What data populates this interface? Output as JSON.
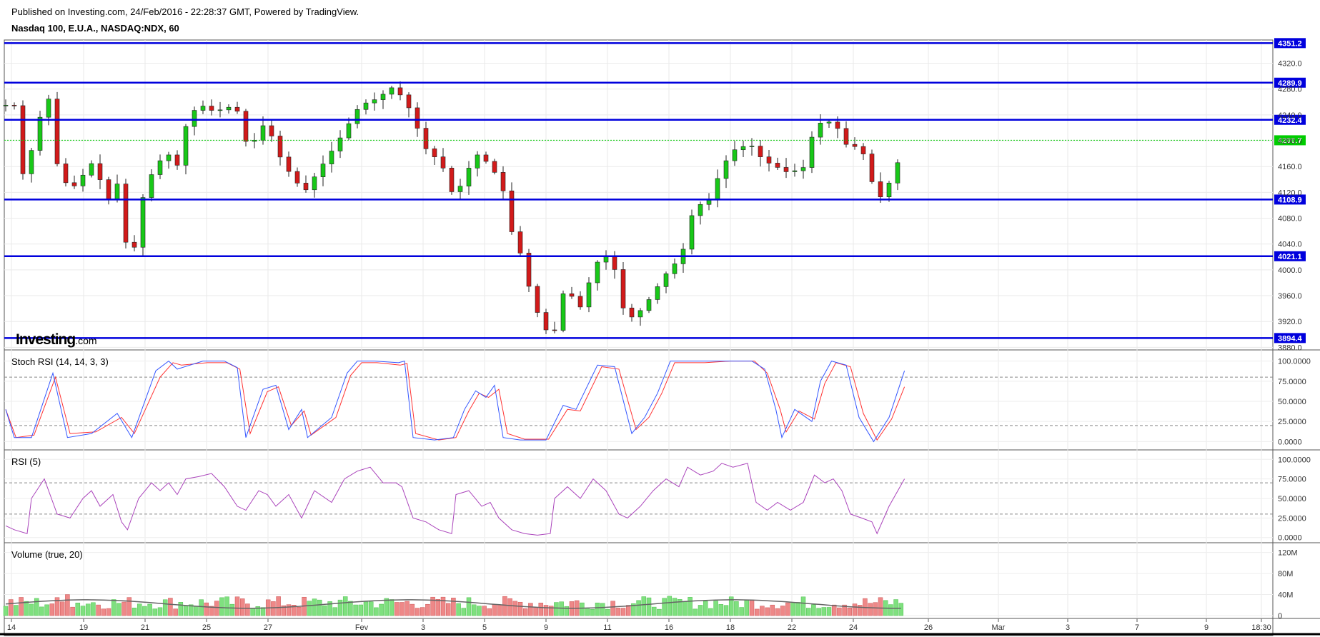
{
  "header": {
    "published": "Published on Investing.com, 24/Feb/2016 - 22:28:37 GMT, Powered by TradingView.",
    "instrument": "Nasdaq 100, E.U.A., NASDAQ:NDX, 60"
  },
  "logo": {
    "main": "Investing",
    "suffix": ".com"
  },
  "colors": {
    "up": "#18c818",
    "down": "#d21a1a",
    "level_line": "#0000dd",
    "current": "#00cc00",
    "stoch_k": "#3355ff",
    "stoch_d": "#ff3333",
    "rsi": "#aa44bb",
    "vol_ma": "#666666"
  },
  "chart_data": [
    {
      "type": "candlestick",
      "title": "Nasdaq 100, E.U.A., NASDAQ:NDX, 60",
      "x_ticks": [
        "14",
        "19",
        "21",
        "25",
        "27",
        "Fev",
        "3",
        "5",
        "9",
        "11",
        "16",
        "18",
        "22",
        "24",
        "26",
        "Mar",
        "3",
        "7",
        "9",
        "18:30"
      ],
      "y_ticks": [
        "4320.0",
        "4280.0",
        "4240.0",
        "4200.0",
        "4160.0",
        "4120.0",
        "4080.0",
        "4040.0",
        "4000.0",
        "3960.0",
        "3920.0",
        "3880.0"
      ],
      "ylim": [
        3876,
        4356
      ],
      "horizontal_levels": [
        "4351.2",
        "4289.9",
        "4232.4",
        "4108.9",
        "4021.1",
        "3894.4"
      ],
      "current_price": "4200.7",
      "grid": true,
      "close_path": [
        [
          0,
          4255
        ],
        [
          5,
          4190
        ],
        [
          12,
          4280
        ],
        [
          18,
          4140
        ],
        [
          26,
          4175
        ],
        [
          36,
          4200
        ],
        [
          47,
          4300
        ],
        [
          58,
          4170
        ],
        [
          70,
          4135
        ],
        [
          80,
          4130
        ],
        [
          92,
          4150
        ],
        [
          103,
          4170
        ],
        [
          118,
          4105
        ],
        [
          133,
          4140
        ],
        [
          142,
          4015
        ],
        [
          152,
          4040
        ],
        [
          162,
          4130
        ],
        [
          178,
          4165
        ],
        [
          188,
          4185
        ],
        [
          198,
          4150
        ],
        [
          213,
          4240
        ],
        [
          228,
          4255
        ],
        [
          243,
          4245
        ],
        [
          268,
          4255
        ],
        [
          283,
          4185
        ],
        [
          303,
          4230
        ],
        [
          323,
          4165
        ],
        [
          348,
          4120
        ],
        [
          368,
          4160
        ],
        [
          388,
          4200
        ],
        [
          413,
          4255
        ],
        [
          433,
          4265
        ],
        [
          453,
          4285
        ],
        [
          473,
          4245
        ],
        [
          488,
          4190
        ],
        [
          508,
          4165
        ],
        [
          523,
          4110
        ],
        [
          548,
          4180
        ],
        [
          563,
          4165
        ],
        [
          578,
          4135
        ],
        [
          593,
          4040
        ],
        [
          603,
          4020
        ],
        [
          613,
          3955
        ],
        [
          628,
          3910
        ],
        [
          638,
          3895
        ],
        [
          653,
          3980
        ],
        [
          668,
          3935
        ],
        [
          688,
          4010
        ],
        [
          703,
          4025
        ],
        [
          713,
          3990
        ],
        [
          723,
          3920
        ],
        [
          743,
          3940
        ],
        [
          758,
          3970
        ],
        [
          773,
          4000
        ],
        [
          788,
          4020
        ],
        [
          798,
          4080
        ],
        [
          808,
          4100
        ],
        [
          823,
          4110
        ],
        [
          833,
          4155
        ],
        [
          848,
          4185
        ],
        [
          868,
          4195
        ],
        [
          883,
          4170
        ],
        [
          898,
          4160
        ],
        [
          913,
          4150
        ],
        [
          933,
          4160
        ],
        [
          943,
          4225
        ],
        [
          958,
          4230
        ],
        [
          968,
          4225
        ],
        [
          978,
          4195
        ],
        [
          993,
          4190
        ],
        [
          1003,
          4175
        ],
        [
          1013,
          4120
        ],
        [
          1023,
          4110
        ],
        [
          1033,
          4145
        ],
        [
          1043,
          4175
        ],
        [
          1048,
          4200
        ]
      ],
      "panels": [
        {
          "name": "Stoch RSI (14, 14, 3, 3)",
          "y_ticks": [
            "100.0000",
            "75.0000",
            "50.0000",
            "25.0000",
            "0.0000"
          ],
          "ylim": [
            -5,
            105
          ],
          "bands": [
            80,
            20
          ],
          "k_points": [
            [
              0,
              40
            ],
            [
              10,
              5
            ],
            [
              30,
              5
            ],
            [
              55,
              85
            ],
            [
              72,
              5
            ],
            [
              100,
              10
            ],
            [
              130,
              35
            ],
            [
              147,
              5
            ],
            [
              175,
              88
            ],
            [
              190,
              100
            ],
            [
              200,
              90
            ],
            [
              230,
              100
            ],
            [
              255,
              100
            ],
            [
              270,
              92
            ],
            [
              280,
              5
            ],
            [
              300,
              65
            ],
            [
              315,
              70
            ],
            [
              330,
              15
            ],
            [
              345,
              40
            ],
            [
              352,
              5
            ],
            [
              380,
              30
            ],
            [
              398,
              85
            ],
            [
              410,
              100
            ],
            [
              430,
              100
            ],
            [
              458,
              98
            ],
            [
              465,
              100
            ],
            [
              475,
              5
            ],
            [
              500,
              2
            ],
            [
              522,
              5
            ],
            [
              535,
              40
            ],
            [
              548,
              63
            ],
            [
              560,
              55
            ],
            [
              570,
              70
            ],
            [
              580,
              5
            ],
            [
              600,
              2
            ],
            [
              630,
              2
            ],
            [
              650,
              45
            ],
            [
              665,
              40
            ],
            [
              690,
              95
            ],
            [
              710,
              93
            ],
            [
              730,
              10
            ],
            [
              745,
              30
            ],
            [
              760,
              60
            ],
            [
              775,
              100
            ],
            [
              790,
              100
            ],
            [
              810,
              100
            ],
            [
              840,
              100
            ],
            [
              870,
              100
            ],
            [
              885,
              90
            ],
            [
              898,
              40
            ],
            [
              905,
              5
            ],
            [
              920,
              40
            ],
            [
              940,
              25
            ],
            [
              950,
              75
            ],
            [
              963,
              100
            ],
            [
              980,
              95
            ],
            [
              995,
              30
            ],
            [
              1012,
              0
            ],
            [
              1030,
              30
            ],
            [
              1048,
              88
            ]
          ],
          "d_points": [
            [
              0,
              40
            ],
            [
              12,
              5
            ],
            [
              33,
              8
            ],
            [
              58,
              80
            ],
            [
              75,
              10
            ],
            [
              105,
              12
            ],
            [
              135,
              30
            ],
            [
              150,
              10
            ],
            [
              180,
              80
            ],
            [
              195,
              98
            ],
            [
              205,
              95
            ],
            [
              235,
              98
            ],
            [
              258,
              98
            ],
            [
              273,
              90
            ],
            [
              285,
              10
            ],
            [
              305,
              62
            ],
            [
              318,
              68
            ],
            [
              333,
              20
            ],
            [
              348,
              38
            ],
            [
              356,
              8
            ],
            [
              385,
              30
            ],
            [
              402,
              82
            ],
            [
              415,
              98
            ],
            [
              433,
              98
            ],
            [
              460,
              95
            ],
            [
              468,
              97
            ],
            [
              478,
              10
            ],
            [
              505,
              2
            ],
            [
              525,
              5
            ],
            [
              540,
              38
            ],
            [
              552,
              60
            ],
            [
              563,
              55
            ],
            [
              575,
              65
            ],
            [
              585,
              10
            ],
            [
              605,
              3
            ],
            [
              633,
              3
            ],
            [
              655,
              40
            ],
            [
              670,
              38
            ],
            [
              695,
              93
            ],
            [
              715,
              90
            ],
            [
              735,
              15
            ],
            [
              750,
              30
            ],
            [
              765,
              60
            ],
            [
              780,
              98
            ],
            [
              795,
              98
            ],
            [
              815,
              98
            ],
            [
              845,
              100
            ],
            [
              873,
              100
            ],
            [
              888,
              85
            ],
            [
              903,
              40
            ],
            [
              910,
              12
            ],
            [
              925,
              38
            ],
            [
              943,
              28
            ],
            [
              955,
              72
            ],
            [
              968,
              98
            ],
            [
              985,
              93
            ],
            [
              1000,
              35
            ],
            [
              1016,
              2
            ],
            [
              1033,
              28
            ],
            [
              1048,
              68
            ]
          ]
        },
        {
          "name": "RSI (5)",
          "y_ticks": [
            "100.0000",
            "75.0000",
            "50.0000",
            "25.0000",
            "0.0000"
          ],
          "ylim": [
            -3,
            103
          ],
          "bands": [
            70,
            30
          ],
          "points": [
            [
              0,
              15
            ],
            [
              10,
              10
            ],
            [
              25,
              5
            ],
            [
              30,
              50
            ],
            [
              45,
              75
            ],
            [
              60,
              30
            ],
            [
              75,
              25
            ],
            [
              90,
              50
            ],
            [
              100,
              60
            ],
            [
              110,
              40
            ],
            [
              125,
              55
            ],
            [
              135,
              20
            ],
            [
              142,
              10
            ],
            [
              155,
              50
            ],
            [
              170,
              70
            ],
            [
              180,
              60
            ],
            [
              190,
              70
            ],
            [
              200,
              55
            ],
            [
              210,
              75
            ],
            [
              225,
              78
            ],
            [
              240,
              82
            ],
            [
              255,
              65
            ],
            [
              270,
              40
            ],
            [
              280,
              35
            ],
            [
              295,
              60
            ],
            [
              305,
              55
            ],
            [
              315,
              40
            ],
            [
              330,
              55
            ],
            [
              345,
              25
            ],
            [
              360,
              60
            ],
            [
              380,
              45
            ],
            [
              395,
              75
            ],
            [
              410,
              85
            ],
            [
              425,
              90
            ],
            [
              440,
              70
            ],
            [
              455,
              70
            ],
            [
              462,
              65
            ],
            [
              475,
              25
            ],
            [
              490,
              20
            ],
            [
              505,
              10
            ],
            [
              520,
              5
            ],
            [
              525,
              55
            ],
            [
              540,
              60
            ],
            [
              555,
              40
            ],
            [
              565,
              45
            ],
            [
              575,
              25
            ],
            [
              590,
              10
            ],
            [
              605,
              5
            ],
            [
              620,
              3
            ],
            [
              635,
              5
            ],
            [
              640,
              50
            ],
            [
              655,
              65
            ],
            [
              670,
              50
            ],
            [
              685,
              75
            ],
            [
              700,
              60
            ],
            [
              715,
              30
            ],
            [
              725,
              25
            ],
            [
              740,
              40
            ],
            [
              755,
              60
            ],
            [
              770,
              75
            ],
            [
              785,
              65
            ],
            [
              795,
              90
            ],
            [
              810,
              80
            ],
            [
              825,
              85
            ],
            [
              835,
              95
            ],
            [
              848,
              90
            ],
            [
              865,
              95
            ],
            [
              875,
              45
            ],
            [
              888,
              35
            ],
            [
              900,
              45
            ],
            [
              915,
              35
            ],
            [
              930,
              45
            ],
            [
              943,
              80
            ],
            [
              955,
              70
            ],
            [
              965,
              75
            ],
            [
              975,
              60
            ],
            [
              985,
              30
            ],
            [
              998,
              25
            ],
            [
              1010,
              20
            ],
            [
              1016,
              5
            ],
            [
              1030,
              40
            ],
            [
              1048,
              75
            ]
          ]
        },
        {
          "name": "Volume (true, 20)",
          "y_ticks": [
            "120M",
            "80M",
            "40M",
            "0"
          ],
          "ylim": [
            0,
            125
          ]
        }
      ]
    }
  ]
}
